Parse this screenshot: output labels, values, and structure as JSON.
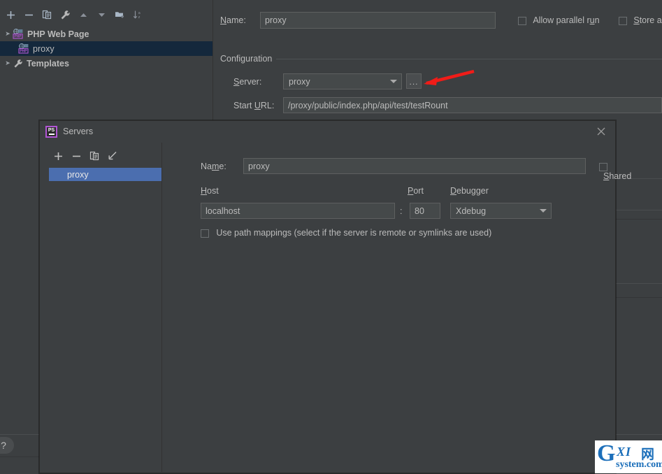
{
  "background_window": {
    "tree_toolbar": [
      {
        "name": "add-icon",
        "glyph": "+"
      },
      {
        "name": "remove-icon",
        "glyph": "-"
      },
      {
        "name": "copy-configuration-icon",
        "glyph": "copy"
      },
      {
        "name": "edit-templates-icon",
        "glyph": "wrench"
      },
      {
        "name": "move-up-icon",
        "glyph": "triangle-up"
      },
      {
        "name": "move-down-icon",
        "glyph": "triangle-down"
      },
      {
        "name": "new-folder-icon",
        "glyph": "folder-plus"
      },
      {
        "name": "sort-alphabetically-icon",
        "glyph": "sort-az"
      }
    ],
    "tree": [
      {
        "label": "PHP Web Page",
        "icon": "php-web-page-icon",
        "expanded": true,
        "bold": true,
        "selected": false,
        "indent": 0
      },
      {
        "label": "proxy",
        "icon": "php-web-page-icon",
        "expanded": null,
        "bold": false,
        "selected": true,
        "indent": 1
      },
      {
        "label": "Templates",
        "icon": "wrench-icon",
        "expanded": false,
        "bold": true,
        "selected": false,
        "indent": 0
      }
    ],
    "form": {
      "name_label": "Name:",
      "name_value": "proxy",
      "allow_parallel_run_label": "Allow parallel run",
      "allow_parallel_run_checked": false,
      "store_as_project_file_label": "Store a",
      "store_as_project_file_checked": false,
      "configuration_section_label": "Configuration",
      "server_label": "Server:",
      "server_value": "proxy",
      "server_browse_label": "...",
      "start_url_label": "Start URL:",
      "start_url_value": "/proxy/public/index.php/api/test/testRount"
    },
    "help_button_label": "?",
    "annotation": {
      "type": "red-arrow",
      "color": "#f01c18",
      "points_to": "server-browse-button"
    }
  },
  "servers_dialog": {
    "title": "Servers",
    "app_icon_text": "PS",
    "close_label": "✕",
    "toolbar": [
      {
        "name": "add-server-icon",
        "glyph": "+"
      },
      {
        "name": "remove-server-icon",
        "glyph": "-"
      },
      {
        "name": "copy-server-icon",
        "glyph": "copy"
      },
      {
        "name": "import-server-icon",
        "glyph": "arrow-down-left"
      }
    ],
    "server_list": [
      {
        "label": "proxy",
        "selected": true
      }
    ],
    "details": {
      "name_label": "Name:",
      "name_value": "proxy",
      "shared_label": "Shared",
      "shared_checked": false,
      "host_label": "Host",
      "host_value": "localhost",
      "colon": ":",
      "port_label": "Port",
      "port_value": "80",
      "debugger_label": "Debugger",
      "debugger_value": "Xdebug",
      "use_path_mappings_label": "Use path mappings (select if the server is remote or symlinks are used)",
      "use_path_mappings_checked": false
    }
  },
  "watermark": {
    "g": "G",
    "xi": "XI",
    "net": "网",
    "domain": "system.com"
  },
  "colors": {
    "window_bg": "#3c3f41",
    "field_bg": "#45494a",
    "tree_selection": "#14283c",
    "list_selection": "#4b6eaf",
    "accent_red": "#f01c18",
    "php_purple": "#b056d4",
    "watermark_blue": "#1c6fba"
  }
}
